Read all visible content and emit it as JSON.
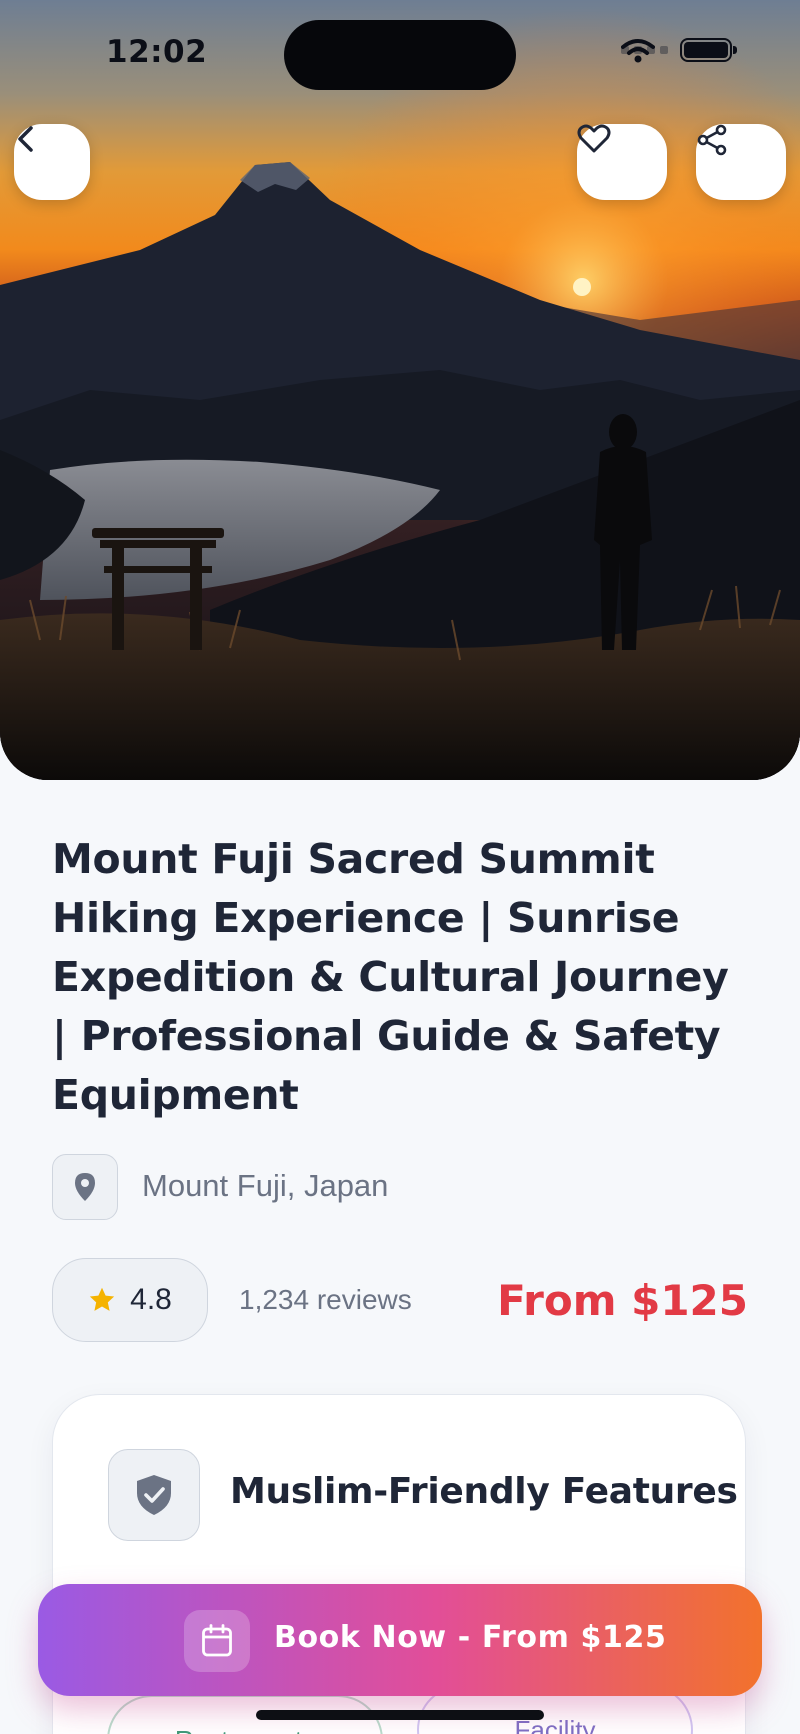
{
  "status_bar": {
    "time": "12:02"
  },
  "hero": {
    "image_icon": "mount-fuji-sunrise-photo",
    "back_icon": "chevron-left-icon",
    "favorite_icon": "heart-icon",
    "share_icon": "share-icon"
  },
  "experience": {
    "title": "Mount Fuji Sacred Summit Hiking Experience | Sunrise Expedition & Cultural Journey | Professional Guide & Safety Equipment",
    "location": "Mount Fuji, Japan",
    "rating": "4.8",
    "reviews": "1,234 reviews",
    "price": "From $125"
  },
  "features": {
    "title": "Muslim-Friendly Features",
    "chips": [
      {
        "label": "Restaurants"
      },
      {
        "label": "Facility"
      }
    ]
  },
  "book": {
    "label": "Book Now - From $125",
    "icon": "calendar-icon"
  },
  "colors": {
    "price": "#e23a45",
    "star": "#f5b301",
    "gradient_start": "#9a5ae4",
    "gradient_mid": "#e24e98",
    "gradient_end": "#f2722c",
    "chip_green": "#3f9b78",
    "chip_purple": "#7d6fc4"
  }
}
